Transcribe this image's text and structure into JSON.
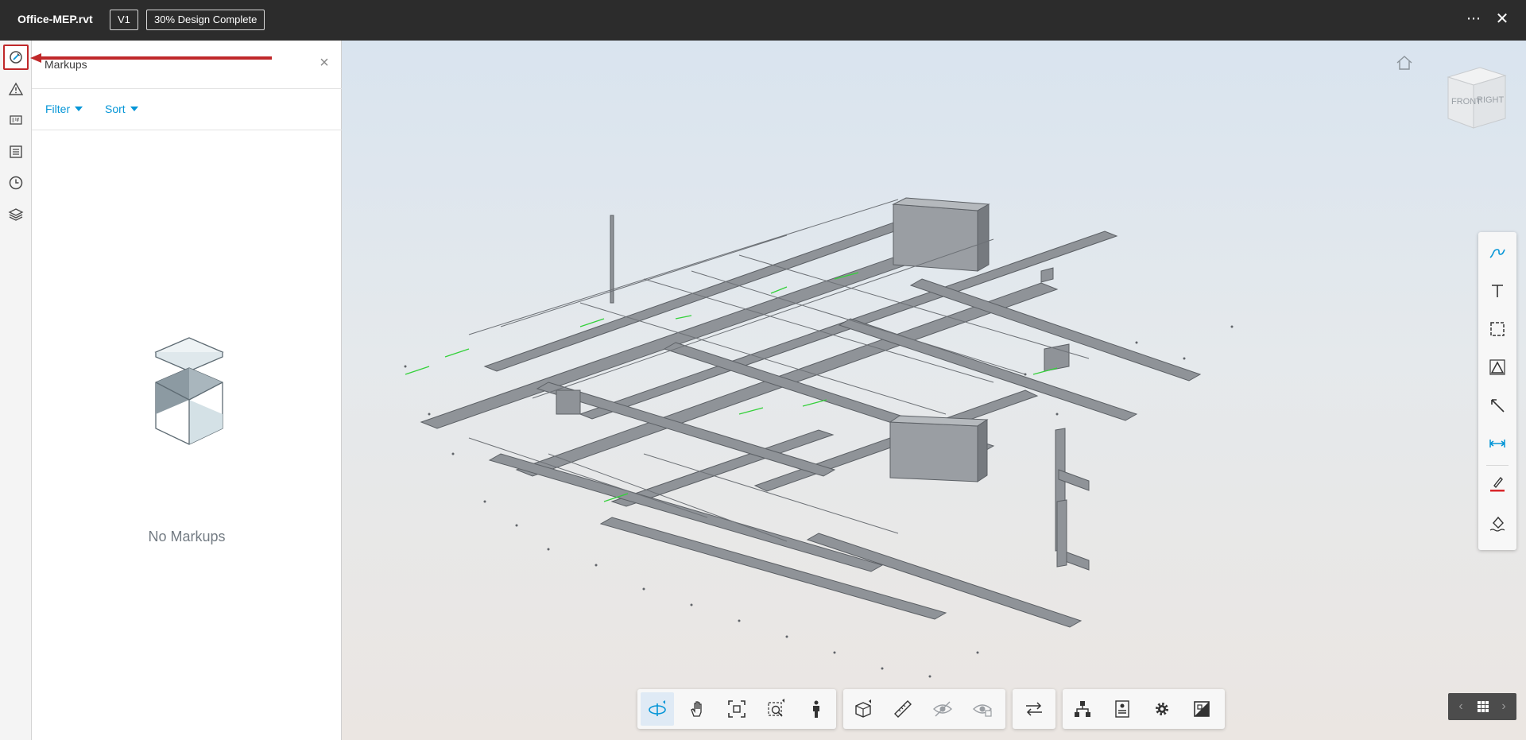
{
  "app": {
    "file_name": "Office-MEP.rvt",
    "version": "V1",
    "set_name": "30% Design Complete",
    "more_label": "⋯",
    "close_label": "✕"
  },
  "rail": {
    "items": [
      {
        "icon": "markups-icon",
        "active": true
      },
      {
        "icon": "issues-icon"
      },
      {
        "icon": "rfi-icon"
      },
      {
        "icon": "sheets-icon"
      },
      {
        "icon": "history-icon"
      },
      {
        "icon": "layers-icon"
      }
    ]
  },
  "panel": {
    "title": "Markups",
    "close_label": "×",
    "filter_label": "Filter",
    "sort_label": "Sort",
    "empty_text": "No Markups"
  },
  "viewcube": {
    "front": "FRONT",
    "right": "RIGHT"
  },
  "markup_tools": [
    {
      "icon": "freehand-icon"
    },
    {
      "icon": "text-icon"
    },
    {
      "icon": "cloud-icon"
    },
    {
      "icon": "polyline-icon"
    },
    {
      "icon": "arrow-icon"
    },
    {
      "icon": "dimension-icon"
    },
    {
      "icon": "pen-color-icon",
      "color": "#d9262a"
    },
    {
      "icon": "fill-icon"
    }
  ],
  "bottom_toolbar": {
    "navigation": [
      "orbit-icon",
      "pan-icon",
      "fit-to-view-icon",
      "zoom-icon",
      "first-person-icon"
    ],
    "modeling": [
      "section-icon",
      "measure-icon",
      "hide-icon",
      "isolate-icon"
    ],
    "compare": [
      "compare-icon"
    ],
    "settings": [
      "model-browser-icon",
      "properties-icon",
      "settings-icon",
      "full-screen-icon"
    ]
  },
  "pager": {
    "prev_label": "‹",
    "next_label": "›"
  },
  "colors": {
    "topbar": "#2c2c2c",
    "accent": "#0696d7",
    "highlight": "#c0282a"
  }
}
